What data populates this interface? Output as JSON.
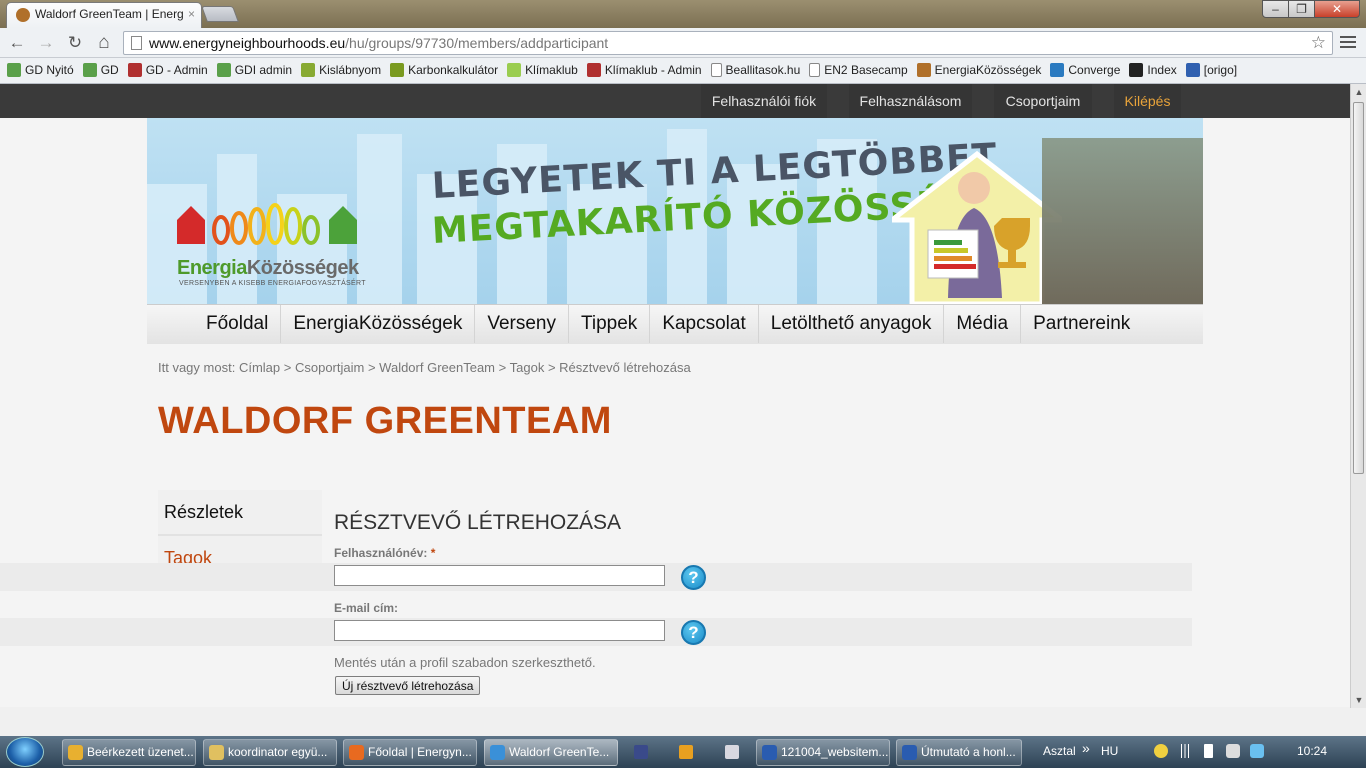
{
  "browser": {
    "tab_title": "Waldorf GreenTeam | Energ",
    "tab_close": "×",
    "url_host": "www.energyneighbourhoods.eu",
    "url_path": "/hu/groups/97730/members/addparticipant",
    "window_buttons": [
      "–",
      "❐",
      "✕"
    ],
    "nav_glyphs": {
      "back": "←",
      "forward": "→",
      "reload": "↻",
      "home": "⌂",
      "star": "☆"
    }
  },
  "bookmarks": [
    {
      "label": "GD Nyitó",
      "color": "#5aa04a"
    },
    {
      "label": "GD",
      "color": "#5aa04a"
    },
    {
      "label": "GD - Admin",
      "color": "#b03030"
    },
    {
      "label": "GDI admin",
      "color": "#5aa04a"
    },
    {
      "label": "Kislábnyom",
      "color": "#88aa33"
    },
    {
      "label": "Karbonkalkulátor",
      "color": "#7a9a20"
    },
    {
      "label": "Klímaklub",
      "color": "#9acd50"
    },
    {
      "label": "Klímaklub - Admin",
      "color": "#b03030"
    },
    {
      "label": "Beallitasok.hu",
      "color": "#ffffff"
    },
    {
      "label": "EN2 Basecamp",
      "color": "#ffffff"
    },
    {
      "label": "EnergiaKözösségek",
      "color": "#b0702a"
    },
    {
      "label": "Converge",
      "color": "#2a7ac0"
    },
    {
      "label": "Index",
      "color": "#222222"
    },
    {
      "label": "[origo]",
      "color": "#3060b0"
    }
  ],
  "user_menu": {
    "items": [
      "Felhasználói fiók",
      "Felhasználásom",
      "Csoportjaim",
      "Kilépés"
    ]
  },
  "banner": {
    "logo_prefix": "Energia",
    "logo_suffix": "Közösségek",
    "logo_tagline": "VERSENYBEN A KISEBB ENERGIAFOGYASZTÁSÉRT",
    "slogan_line1": "LEGYETEK TI A LEGTÖBBET",
    "slogan_line2": "MEGTAKARÍTÓ KÖZÖSSÉG!"
  },
  "main_nav": [
    "Főoldal",
    "EnergiaKözösségek",
    "Verseny",
    "Tippek",
    "Kapcsolat",
    "Letölthető anyagok",
    "Média",
    "Partnereink"
  ],
  "breadcrumb": {
    "prefix": "Itt vagy most:",
    "items": [
      "Címlap",
      "Csoportjaim",
      "Waldorf GreenTeam",
      "Tagok",
      "Résztvevő létrehozása"
    ],
    "separator": ">"
  },
  "group_title": "WALDORF GREENTEAM",
  "side_menu": {
    "details": "Részletek",
    "members": "Tagok"
  },
  "form": {
    "title": "RÉSZTVEVŐ LÉTREHOZÁSA",
    "username_label": "Felhasználónév:",
    "required_mark": "*",
    "username_value": "",
    "email_label": "E-mail cím:",
    "email_value": "",
    "help_glyph": "?",
    "note": "Mentés után a profil szabadon szerkeszthető.",
    "submit_label": "Új résztvevő létrehozása"
  },
  "taskbar": {
    "tasks": [
      {
        "label": "Beérkezett üzenet...",
        "color": "#e8b030"
      },
      {
        "label": "koordinator együ...",
        "color": "#e0c060"
      },
      {
        "label": "Főoldal | Energyn...",
        "color": "#e86a20"
      },
      {
        "label": "Waldorf GreenTe...",
        "color": "#3a90d8"
      },
      {
        "label": "121004_websitem...",
        "color": "#2a5cb0"
      },
      {
        "label": "Útmutató a honl...",
        "color": "#2a5cb0"
      }
    ],
    "desktop_label": "Asztal",
    "chevron": "»",
    "language": "HU",
    "clock": "10:24"
  },
  "colors": {
    "accent": "#c0470f",
    "topbar": "#3a3a3a",
    "logout": "#e8a33a"
  }
}
